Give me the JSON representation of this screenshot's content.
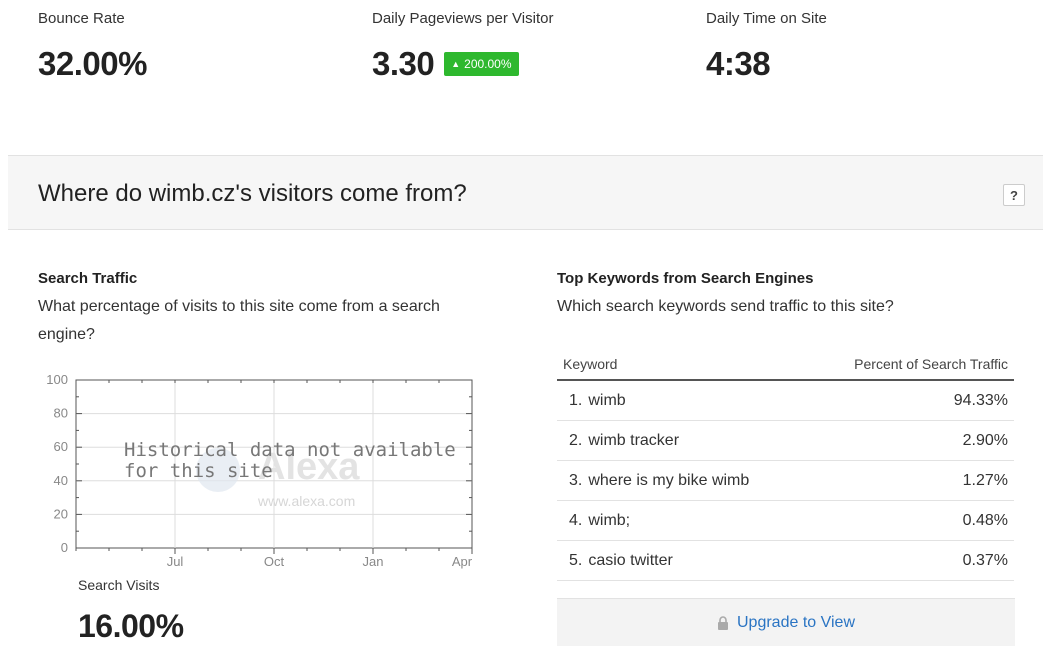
{
  "metrics": [
    {
      "label": "Bounce Rate",
      "value": "32.00%"
    },
    {
      "label": "Daily Pageviews per Visitor",
      "value": "3.30",
      "delta": "200.00%",
      "delta_color": "#2eb82e"
    },
    {
      "label": "Daily Time on Site",
      "value": "4:38"
    }
  ],
  "section": {
    "title": "Where do wimb.cz's visitors come from?",
    "help_label": "?"
  },
  "search_traffic": {
    "title": "Search Traffic",
    "description_line1": "What percentage of visits to this site come from a search",
    "description_line2": "engine?",
    "overlay_text_line1": "Historical data not available",
    "overlay_text_line2": "for this site",
    "watermark_logo": "Alexa",
    "watermark_url": "www.alexa.com",
    "visits_label": "Search Visits",
    "visits_value": "16.00%"
  },
  "chart_data": {
    "type": "line",
    "title": "",
    "y_ticks": [
      0,
      20,
      40,
      60,
      80,
      100
    ],
    "x_ticks": [
      "Jul",
      "Oct",
      "Jan",
      "Apr"
    ],
    "ylim": [
      0,
      100
    ],
    "grid": true,
    "series": []
  },
  "keywords": {
    "title": "Top Keywords from Search Engines",
    "description": "Which search keywords send traffic to this site?",
    "columns": [
      "Keyword",
      "Percent of Search Traffic"
    ],
    "rows": [
      {
        "num": "1.",
        "keyword": "wimb",
        "percent": "94.33%"
      },
      {
        "num": "2.",
        "keyword": "wimb tracker",
        "percent": "2.90%"
      },
      {
        "num": "3.",
        "keyword": "where is my bike wimb",
        "percent": "1.27%"
      },
      {
        "num": "4.",
        "keyword": "wimb;",
        "percent": "0.48%"
      },
      {
        "num": "5.",
        "keyword": "casio twitter",
        "percent": "0.37%"
      }
    ],
    "upgrade_label": "Upgrade to View"
  }
}
